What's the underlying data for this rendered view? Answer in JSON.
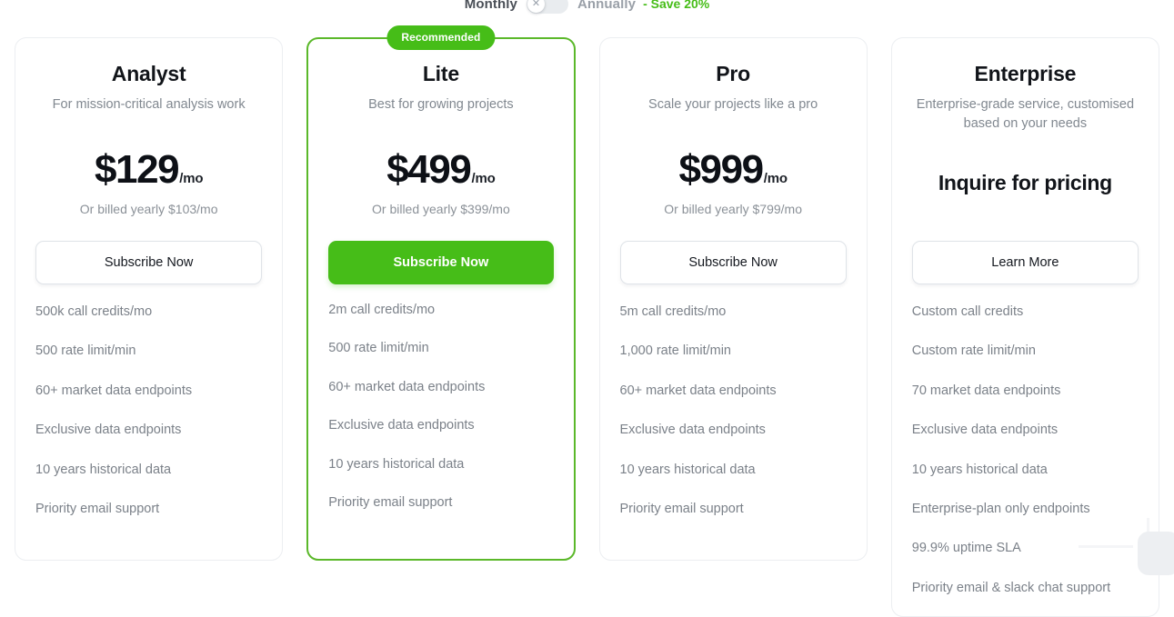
{
  "billing": {
    "monthly_label": "Monthly",
    "annually_label": "Annually",
    "save_label": "- Save 20%",
    "toggle_state": "monthly",
    "toggle_icon": "close-icon",
    "accent_color": "#46bd18"
  },
  "ribbon": {
    "label": "Recommended"
  },
  "plans": [
    {
      "name": "Analyst",
      "tagline": "For mission-critical analysis work",
      "price_amount": "$129",
      "price_period": "/mo",
      "price_sub": "Or billed yearly $103/mo",
      "cta_label": "Subscribe Now",
      "cta_style": "outline",
      "featured": false,
      "features": [
        "500k call credits/mo",
        "500 rate limit/min",
        "60+ market data endpoints",
        "Exclusive data endpoints",
        "10 years historical data",
        "Priority email support"
      ]
    },
    {
      "name": "Lite",
      "tagline": "Best for growing projects",
      "price_amount": "$499",
      "price_period": "/mo",
      "price_sub": "Or billed yearly $399/mo",
      "cta_label": "Subscribe Now",
      "cta_style": "solid",
      "featured": true,
      "features": [
        "2m call credits/mo",
        "500 rate limit/min",
        "60+ market data endpoints",
        "Exclusive data endpoints",
        "10 years historical data",
        "Priority email support"
      ]
    },
    {
      "name": "Pro",
      "tagline": "Scale your projects like a pro",
      "price_amount": "$999",
      "price_period": "/mo",
      "price_sub": "Or billed yearly $799/mo",
      "cta_label": "Subscribe Now",
      "cta_style": "outline",
      "featured": false,
      "features": [
        "5m call credits/mo",
        "1,000 rate limit/min",
        "60+ market data endpoints",
        "Exclusive data endpoints",
        "10 years historical data",
        "Priority email support"
      ]
    },
    {
      "name": "Enterprise",
      "tagline": "Enterprise-grade service, customised based on your needs",
      "price_custom": "Inquire for pricing",
      "cta_label": "Learn More",
      "cta_style": "outline",
      "featured": false,
      "features": [
        "Custom call credits",
        "Custom rate limit/min",
        "70 market data endpoints",
        "Exclusive data endpoints",
        "10 years historical data",
        "Enterprise-plan only endpoints",
        "99.9% uptime SLA",
        "Priority email & slack chat support"
      ]
    }
  ]
}
